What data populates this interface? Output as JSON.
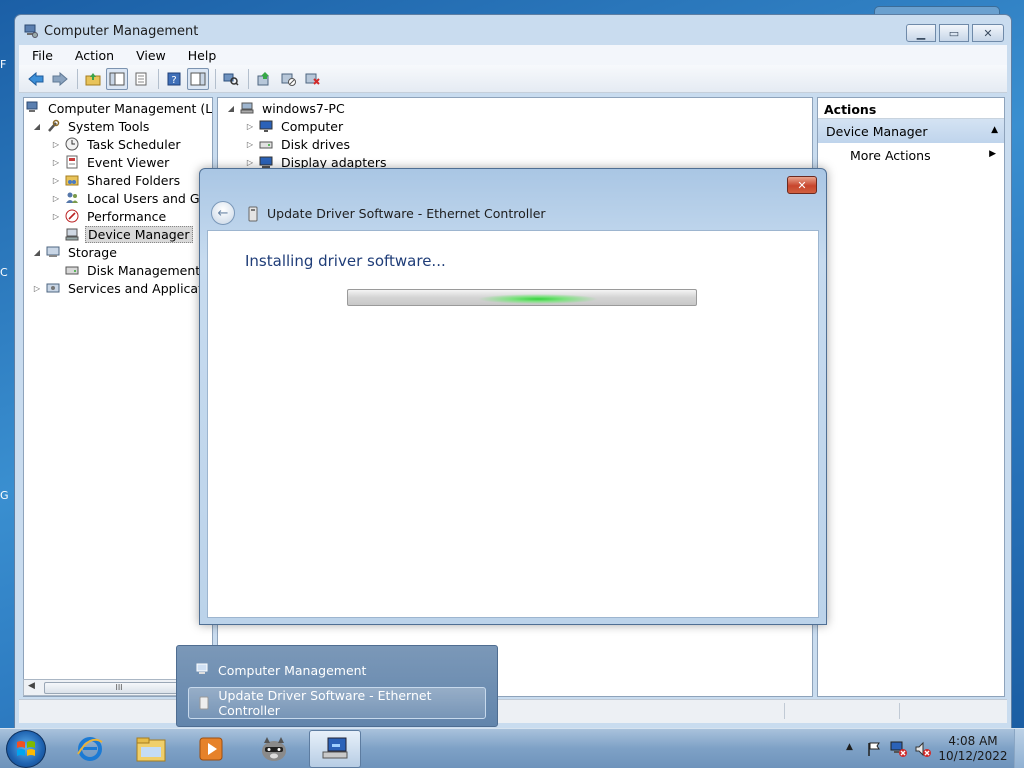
{
  "desktop": {
    "fragments": [
      "F",
      "C",
      "G"
    ]
  },
  "window": {
    "title": "Computer Management",
    "min_glyph": "▁",
    "max_glyph": "▭",
    "close_glyph": "✕"
  },
  "menu": {
    "file": "File",
    "action": "Action",
    "view": "View",
    "help": "Help"
  },
  "toolbar": {
    "icons": [
      "back-arrow-icon",
      "forward-arrow-icon",
      "up-folder-icon",
      "show-hide-tree-icon",
      "properties-icon",
      "help-icon",
      "show-hide-action-pane-icon",
      "scan-hardware-icon",
      "update-driver-icon",
      "disable-device-icon",
      "uninstall-device-icon"
    ]
  },
  "tree": {
    "root": "Computer Management (Local",
    "system_tools": "System Tools",
    "task_scheduler": "Task Scheduler",
    "event_viewer": "Event Viewer",
    "shared_folders": "Shared Folders",
    "local_users": "Local Users and Group",
    "performance": "Performance",
    "device_manager": "Device Manager",
    "storage": "Storage",
    "disk_management": "Disk Management",
    "services": "Services and Applications",
    "scroll_thumb": "III"
  },
  "devices": {
    "pc": "windows7-PC",
    "computer": "Computer",
    "disk_drives": "Disk drives",
    "display_adapters": "Display adapters"
  },
  "actions": {
    "header": "Actions",
    "section": "Device Manager",
    "more": "More Actions"
  },
  "dialog": {
    "title": "Update Driver Software - Ethernet Controller",
    "heading": "Installing driver software...",
    "close_glyph": "✕",
    "back_glyph": "←"
  },
  "taskbar_popup": {
    "item1": "Computer Management",
    "item2": "Update Driver Software - Ethernet Controller"
  },
  "clock": {
    "time": "4:08 AM",
    "date": "10/12/2022"
  },
  "colors": {
    "accent": "#1f3d78",
    "progress_glow": "#34d23c",
    "selection": "#bfd4ec"
  }
}
